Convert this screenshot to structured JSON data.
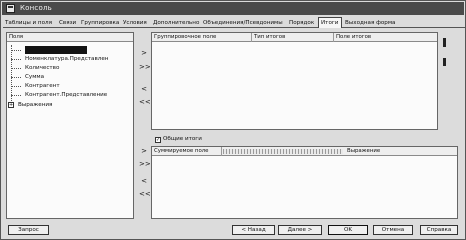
{
  "window": {
    "title": "Консоль"
  },
  "tabs": [
    "Таблицы и поля",
    "Связи",
    "Группировка",
    "Условия",
    "Дополнительно",
    "Объединения/Псевдонимы",
    "Порядок",
    "Итоги",
    "Выходная форма"
  ],
  "active_tab": "Итоги",
  "fields_panel": {
    "header": "Поля",
    "tree": [
      {
        "label": "",
        "selected": true
      },
      {
        "label": "Номенклатура.Представлен"
      },
      {
        "label": "Количество"
      },
      {
        "label": "Сумма"
      },
      {
        "label": "Контрагент"
      },
      {
        "label": "Контрагент.Представление"
      },
      {
        "label": "Выражения",
        "root": true
      }
    ]
  },
  "grouping_panel": {
    "columns": [
      "Группировочное поле",
      "Тип итогов",
      "Поле итогов"
    ]
  },
  "overall": {
    "checkbox_label": "Общие итоги",
    "checked": true
  },
  "totals_panel": {
    "columns": [
      "Суммируемое поле",
      "Выражение"
    ]
  },
  "side_buttons_top": [
    ">",
    ">>",
    "<",
    "<<"
  ],
  "side_buttons_bottom": [
    ">",
    ">>",
    "<",
    "<<"
  ],
  "footer": {
    "query_button": "Запрос",
    "back_button": "< Назад",
    "next_button": "Далее >",
    "ok_button": "OK",
    "cancel_button": "Отмена",
    "help_button": "Справка"
  }
}
